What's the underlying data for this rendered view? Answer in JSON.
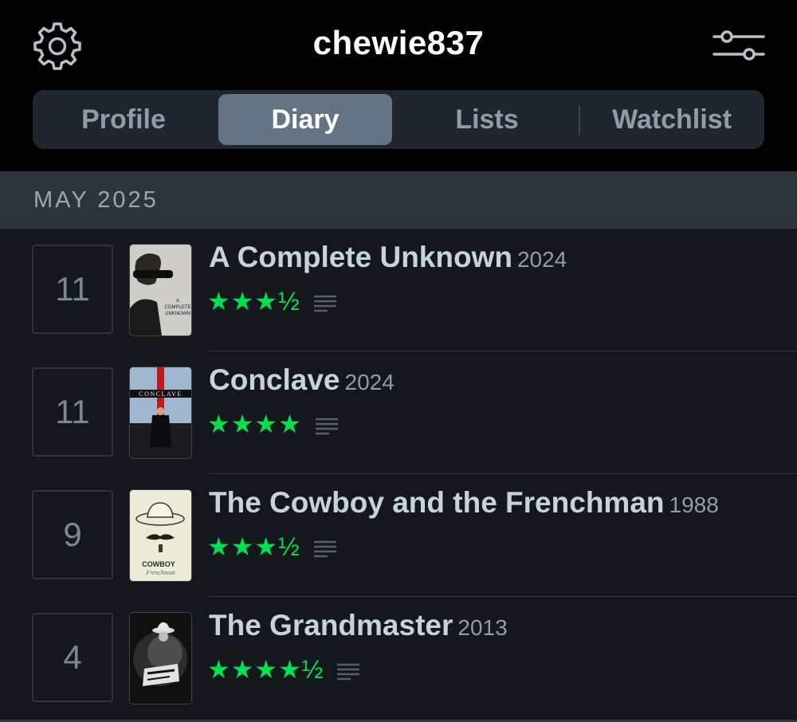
{
  "header": {
    "username": "chewie837",
    "settings_icon": "gear-icon",
    "filter_icon": "sliders-icon"
  },
  "tabs": [
    {
      "label": "Profile",
      "active": false
    },
    {
      "label": "Diary",
      "active": true
    },
    {
      "label": "Lists",
      "active": false
    },
    {
      "label": "Watchlist",
      "active": false
    }
  ],
  "diary": {
    "month": "MAY 2025",
    "entries": [
      {
        "day": "11",
        "title": "A Complete Unknown",
        "year": "2024",
        "stars": "★★★½",
        "rating": 3.5,
        "has_review": true
      },
      {
        "day": "11",
        "title": "Conclave",
        "year": "2024",
        "stars": "★★★★",
        "rating": 4,
        "has_review": true
      },
      {
        "day": "9",
        "title": "The Cowboy and the Frenchman",
        "year": "1988",
        "stars": "★★★½",
        "rating": 3.5,
        "has_review": true
      },
      {
        "day": "4",
        "title": "The Grandmaster",
        "year": "2013",
        "stars": "★★★★½",
        "rating": 4.5,
        "has_review": true
      }
    ]
  },
  "colors": {
    "background": "#14181c",
    "header": "#000000",
    "accent_green": "#00e054",
    "active_tab": "#647485"
  }
}
